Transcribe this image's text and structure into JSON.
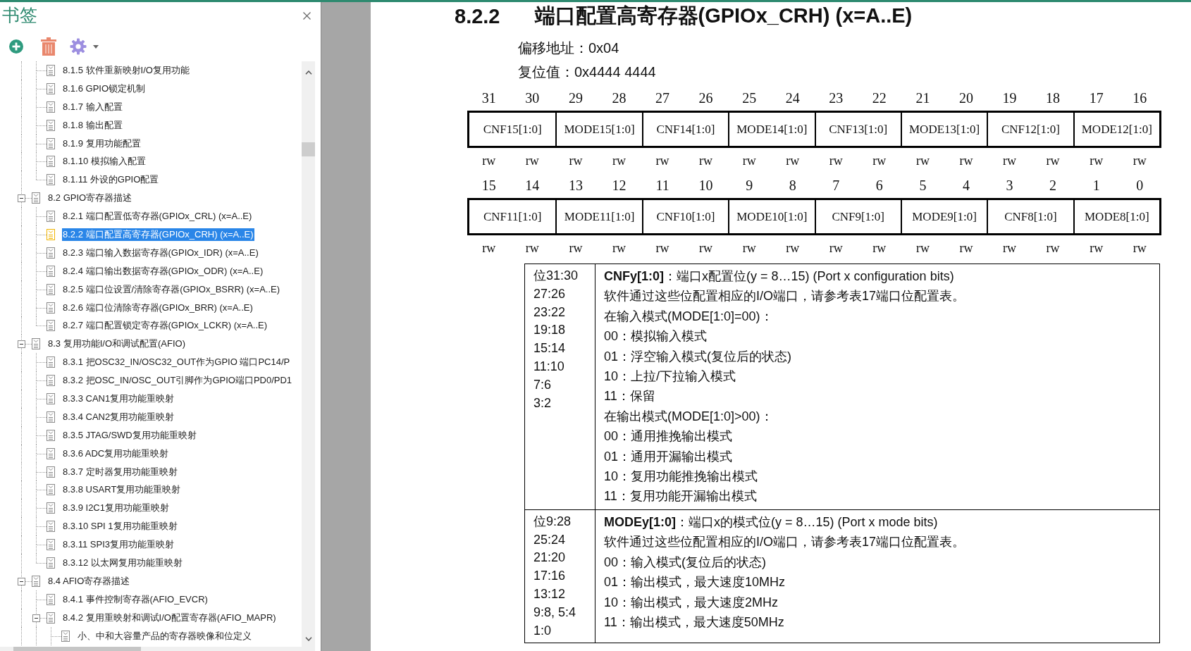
{
  "sidebar": {
    "title": "书签",
    "tree": [
      {
        "children": [
          {
            "label": "8.1.5 软件重新映射I/O复用功能",
            "selected": false
          },
          {
            "label": "8.1.6 GPIO锁定机制",
            "selected": false
          },
          {
            "label": "8.1.7 输入配置",
            "selected": false
          },
          {
            "label": "8.1.8 输出配置",
            "selected": false
          },
          {
            "label": "8.1.9 复用功能配置",
            "selected": false
          },
          {
            "label": "8.1.10 模拟输入配置",
            "selected": false
          },
          {
            "label": "8.1.11 外设的GPIO配置",
            "selected": false
          }
        ]
      },
      {
        "label": "8.2 GPIO寄存器描述",
        "selected": false,
        "expanded": true,
        "children": [
          {
            "label": "8.2.1 端口配置低寄存器(GPIOx_CRL) (x=A..E)",
            "selected": false
          },
          {
            "label": "8.2.2 端口配置高寄存器(GPIOx_CRH) (x=A..E)",
            "selected": true
          },
          {
            "label": "8.2.3 端口输入数据寄存器(GPIOx_IDR) (x=A..E)",
            "selected": false
          },
          {
            "label": "8.2.4 端口输出数据寄存器(GPIOx_ODR) (x=A..E)",
            "selected": false
          },
          {
            "label": "8.2.5 端口位设置/清除寄存器(GPIOx_BSRR) (x=A..E)",
            "selected": false
          },
          {
            "label": "8.2.6 端口位清除寄存器(GPIOx_BRR) (x=A..E)",
            "selected": false
          },
          {
            "label": "8.2.7 端口配置锁定寄存器(GPIOx_LCKR) (x=A..E)",
            "selected": false
          }
        ]
      },
      {
        "label": "8.3 复用功能I/O和调试配置(AFIO)",
        "selected": false,
        "expanded": true,
        "children": [
          {
            "label": "8.3.1 把OSC32_IN/OSC32_OUT作为GPIO 端口PC14/P",
            "selected": false
          },
          {
            "label": "8.3.2 把OSC_IN/OSC_OUT引脚作为GPIO端口PD0/PD1",
            "selected": false
          },
          {
            "label": "8.3.3 CAN1复用功能重映射",
            "selected": false
          },
          {
            "label": "8.3.4 CAN2复用功能重映射",
            "selected": false
          },
          {
            "label": "8.3.5 JTAG/SWD复用功能重映射",
            "selected": false
          },
          {
            "label": "8.3.6 ADC复用功能重映射",
            "selected": false
          },
          {
            "label": "8.3.7 定时器复用功能重映射",
            "selected": false
          },
          {
            "label": "8.3.8 USART复用功能重映射",
            "selected": false
          },
          {
            "label": "8.3.9 I2C1复用功能重映射",
            "selected": false
          },
          {
            "label": "8.3.10 SPI 1复用功能重映射",
            "selected": false
          },
          {
            "label": "8.3.11 SPI3复用功能重映射",
            "selected": false
          },
          {
            "label": "8.3.12 以太网复用功能重映射",
            "selected": false
          }
        ]
      },
      {
        "label": "8.4 AFIO寄存器描述",
        "selected": false,
        "expanded": true,
        "children": [
          {
            "label": "8.4.1 事件控制寄存器(AFIO_EVCR)",
            "selected": false
          },
          {
            "label": "8.4.2 复用重映射和调试I/O配置寄存器(AFIO_MAPR)",
            "selected": false,
            "expanded": true,
            "children": [
              {
                "label": "小、中和大容量产品的寄存器映像和位定义",
                "selected": false
              }
            ]
          }
        ]
      }
    ]
  },
  "document": {
    "heading_number": "8.2.2",
    "heading_title": "端口配置高寄存器(GPIOx_CRH) (x=A..E)",
    "offset": "偏移地址：0x04",
    "reset": "复位值：0x4444 4444",
    "register_rows": [
      {
        "bits": [
          "31",
          "30",
          "29",
          "28",
          "27",
          "26",
          "25",
          "24",
          "23",
          "22",
          "21",
          "20",
          "19",
          "18",
          "17",
          "16"
        ],
        "fields": [
          "CNF15[1:0]",
          "MODE15[1:0]",
          "CNF14[1:0]",
          "MODE14[1:0]",
          "CNF13[1:0]",
          "MODE13[1:0]",
          "CNF12[1:0]",
          "MODE12[1:0]"
        ],
        "access": [
          "rw",
          "rw",
          "rw",
          "rw",
          "rw",
          "rw",
          "rw",
          "rw",
          "rw",
          "rw",
          "rw",
          "rw",
          "rw",
          "rw",
          "rw",
          "rw"
        ]
      },
      {
        "bits": [
          "15",
          "14",
          "13",
          "12",
          "11",
          "10",
          "9",
          "8",
          "7",
          "6",
          "5",
          "4",
          "3",
          "2",
          "1",
          "0"
        ],
        "fields": [
          "CNF11[1:0]",
          "MODE11[1:0]",
          "CNF10[1:0]",
          "MODE10[1:0]",
          "CNF9[1:0]",
          "MODE9[1:0]",
          "CNF8[1:0]",
          "MODE8[1:0]"
        ],
        "access": [
          "rw",
          "rw",
          "rw",
          "rw",
          "rw",
          "rw",
          "rw",
          "rw",
          "rw",
          "rw",
          "rw",
          "rw",
          "rw",
          "rw",
          "rw",
          "rw"
        ]
      }
    ],
    "descriptions": [
      {
        "bits": [
          "位31:30",
          "27:26",
          "23:22",
          "19:18",
          "15:14",
          "11:10",
          "7:6",
          "3:2"
        ],
        "lines": [
          "**CNFy[1:0]**：端口x配置位(y = 8…15) (Port x configuration bits)",
          "软件通过这些位配置相应的I/O端口，请参考表17端口位配置表。",
          "在输入模式(MODE[1:0]=00)：",
          "00：模拟输入模式",
          "01：浮空输入模式(复位后的状态)",
          "10：上拉/下拉输入模式",
          "11：保留",
          "在输出模式(MODE[1:0]>00)：",
          "00：通用推挽输出模式",
          "01：通用开漏输出模式",
          "10：复用功能推挽输出模式",
          "11：复用功能开漏输出模式"
        ]
      },
      {
        "bits": [
          "位9:28",
          "25:24",
          "21:20",
          "17:16",
          "13:12",
          "9:8, 5:4",
          "1:0"
        ],
        "lines": [
          "**MODEy[1:0]**：端口x的模式位(y = 8…15) (Port x mode bits)",
          "软件通过这些位配置相应的I/O端口，请参考表17端口位配置表。",
          "00：输入模式(复位后的状态)",
          "01：输出模式，最大速度10MHz",
          "10：输出模式，最大速度2MHz",
          "11：输出模式，最大速度50MHz"
        ]
      }
    ]
  }
}
